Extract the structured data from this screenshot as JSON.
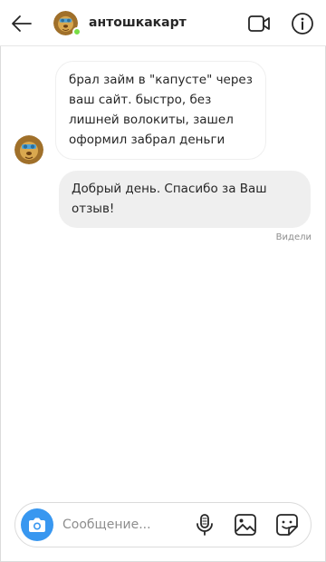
{
  "header": {
    "username": "антошкакарт",
    "online": true
  },
  "icons": {
    "back": "arrow-left-icon",
    "video": "video-camera-icon",
    "info": "info-icon",
    "camera": "camera-icon",
    "mic": "microphone-icon",
    "gallery": "image-icon",
    "sticker": "sticker-icon"
  },
  "messages": [
    {
      "direction": "incoming",
      "text": "брал займ в \"капусте\" через ваш сайт. быстро, без лишней волокиты, зашел оформил забрал деньги"
    },
    {
      "direction": "outgoing",
      "text": "Добрый день. Спасибо за Ваш отзыв!"
    }
  ],
  "status": {
    "seen": "Видели"
  },
  "composer": {
    "placeholder": "Сообщение..."
  },
  "colors": {
    "accent": "#3897f0",
    "online": "#78de45",
    "outgoing_bubble": "#efefef",
    "border": "#dbdbdb"
  }
}
